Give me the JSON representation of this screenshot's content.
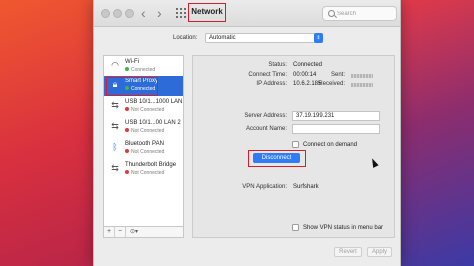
{
  "window": {
    "title": "Network",
    "search_placeholder": "Search"
  },
  "location": {
    "label": "Location:",
    "value": "Automatic"
  },
  "sidebar": {
    "services": [
      {
        "name": "Wi-Fi",
        "status": "Connected",
        "status_color": "#3cb54a",
        "icon": "wifi-icon"
      },
      {
        "name": "Smart Proxy",
        "status": "Connected",
        "status_color": "#3cb54a",
        "icon": "lock-icon",
        "selected": true
      },
      {
        "name": "USB 10/1...1000 LAN",
        "status": "Not Connected",
        "status_color": "#e0383b",
        "icon": "ethernet-icon"
      },
      {
        "name": "USB 10/1...00 LAN 2",
        "status": "Not Connected",
        "status_color": "#e0383b",
        "icon": "ethernet-icon"
      },
      {
        "name": "Bluetooth PAN",
        "status": "Not Connected",
        "status_color": "#e0383b",
        "icon": "bluetooth-icon"
      },
      {
        "name": "Thunderbolt Bridge",
        "status": "Not Connected",
        "status_color": "#e0383b",
        "icon": "thunderbolt-icon"
      }
    ],
    "add_label": "+",
    "remove_label": "−",
    "action_label": "⊙▾"
  },
  "details": {
    "status_label": "Status:",
    "status_value": "Connected",
    "connect_time_label": "Connect Time:",
    "connect_time_value": "00:00:14",
    "ip_label": "IP Address:",
    "ip_value": "10.6.2.185",
    "sent_label": "Sent:",
    "received_label": "Received:",
    "server_label": "Server Address:",
    "server_value": "37.19.199.231",
    "account_label": "Account Name:",
    "account_value": "",
    "connect_on_demand": "Connect on demand",
    "disconnect_label": "Disconnect",
    "vpn_app_label": "VPN Application:",
    "vpn_app_value": "Surfshark",
    "show_status_label": "Show VPN status in menu bar"
  },
  "footer": {
    "revert": "Revert",
    "apply": "Apply"
  },
  "colors": {
    "accent": "#2e7cf6",
    "highlight": "#d81e2c"
  }
}
